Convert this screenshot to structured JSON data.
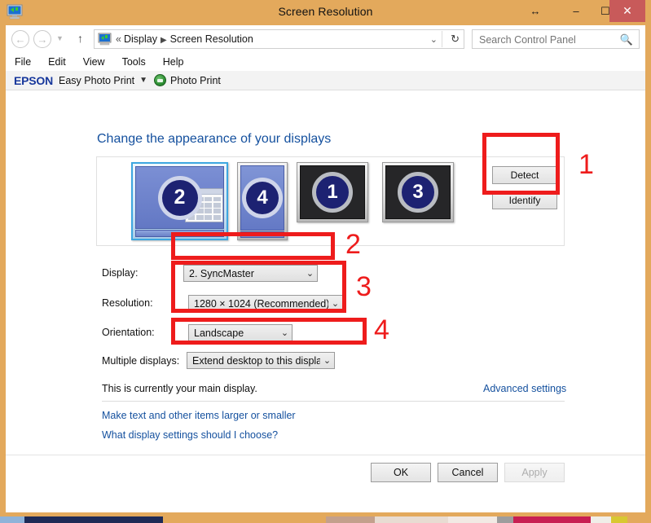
{
  "window": {
    "title": "Screen Resolution",
    "app_icon": "monitor-icon",
    "controls": {
      "resize": "↔",
      "minimize": "–",
      "maximize": "☐",
      "close": "✕"
    }
  },
  "addressbar": {
    "back_icon": "←",
    "forward_icon": "→",
    "history_caret": "▼",
    "up_icon": "↑",
    "breadcrumb_icon": "monitor-icon",
    "breadcrumb_chevrons": "«",
    "breadcrumb_root": "Display",
    "breadcrumb_arrow": "▶",
    "breadcrumb_current": "Screen Resolution",
    "dropdown_caret": "⌄",
    "refresh_icon": "↻"
  },
  "search": {
    "placeholder": "Search Control Panel",
    "value": "",
    "icon": "🔍"
  },
  "menu": {
    "items": [
      "File",
      "Edit",
      "View",
      "Tools",
      "Help"
    ]
  },
  "epson_toolbar": {
    "logo": "EPSON",
    "easy_photo_print": "Easy Photo Print",
    "caret": "▼",
    "printer_icon": "printer-icon",
    "photo_print": "Photo Print"
  },
  "content": {
    "heading": "Change the appearance of your displays",
    "detect_button": "Detect",
    "identify_button": "Identify",
    "monitors": [
      {
        "number": "2",
        "state": "selected-active"
      },
      {
        "number": "4",
        "state": "active"
      },
      {
        "number": "1",
        "state": "inactive"
      },
      {
        "number": "3",
        "state": "inactive"
      }
    ],
    "form": {
      "display_label": "Display:",
      "display_value": "2. SyncMaster",
      "resolution_label": "Resolution:",
      "resolution_value": "1280 × 1024 (Recommended)",
      "orientation_label": "Orientation:",
      "orientation_value": "Landscape",
      "multiple_displays_label": "Multiple displays:",
      "multiple_displays_value": "Extend desktop to this display",
      "caret": "⌄"
    },
    "main_display_status": "This is currently your main display.",
    "advanced_settings_link": "Advanced settings",
    "link_make_text_larger": "Make text and other items larger or smaller",
    "link_what_settings": "What display settings should I choose?"
  },
  "footer": {
    "ok": "OK",
    "cancel": "Cancel",
    "apply": "Apply"
  },
  "annotations": {
    "num1": "1",
    "num2": "2",
    "num3": "3",
    "num4": "4",
    "color": "#ee1c1c"
  },
  "colors": {
    "window_frame": "#e3a95c",
    "close_button": "#c85a5a",
    "link": "#14509e",
    "heading": "#14509e",
    "epson_blue": "#18389c",
    "annotation_red": "#ee1c1c",
    "monitor_active": "#6378c4",
    "monitor_inactive": "#262628",
    "monitor_number_circle": "#1d2272"
  }
}
